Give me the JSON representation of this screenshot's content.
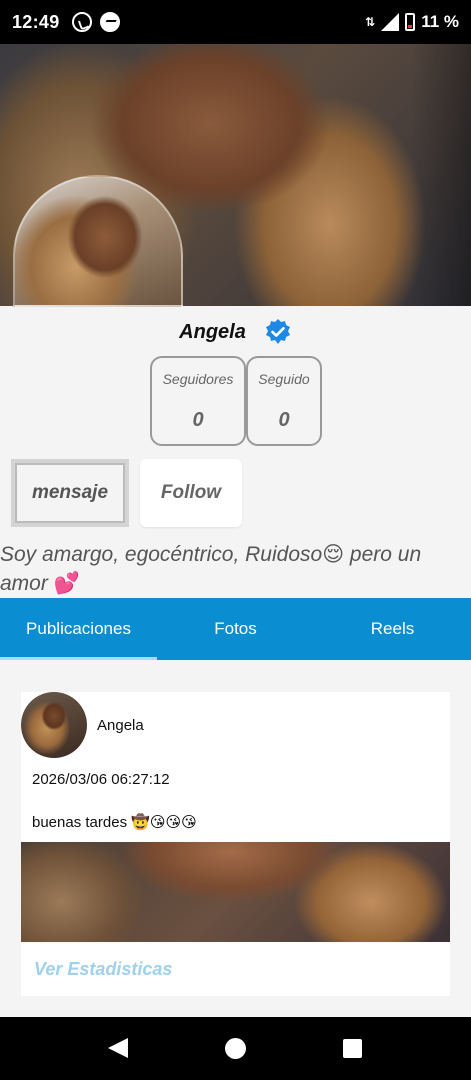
{
  "status_bar": {
    "time": "12:49",
    "app_icons": [
      "whatsapp-icon",
      "messenger-icon"
    ],
    "battery_text": "11 %"
  },
  "profile": {
    "name": "Angela",
    "verified": true,
    "stats": {
      "followers_label": "Seguidores",
      "followers_value": "0",
      "following_label": "Seguido",
      "following_value": "0"
    },
    "actions": {
      "message_label": "mensaje",
      "follow_label": "Follow"
    },
    "bio": {
      "line1_text": "Soy amargo, egocéntrico, Ruidoso",
      "line1_emoji": "😌",
      "line1_tail": " pero un",
      "line2_text": "amor ",
      "line2_emoji": "💕"
    }
  },
  "tabs": [
    {
      "label": "Publicaciones",
      "active": true
    },
    {
      "label": "Fotos",
      "active": false
    },
    {
      "label": "Reels",
      "active": false
    }
  ],
  "post": {
    "author": "Angela",
    "date": "2026/03/06 06:27:12",
    "text": "buenas tardes 🤠😘😘😘",
    "stats_link": "Ver Estadisticas"
  },
  "colors": {
    "tab_bar": "#0a8dd1",
    "tab_indicator": "#a8dbf7",
    "verified_badge": "#1e88e5",
    "stats_link": "#9fd1ef"
  },
  "navbar": {
    "icons": [
      "back-icon",
      "home-icon",
      "recents-icon"
    ]
  }
}
